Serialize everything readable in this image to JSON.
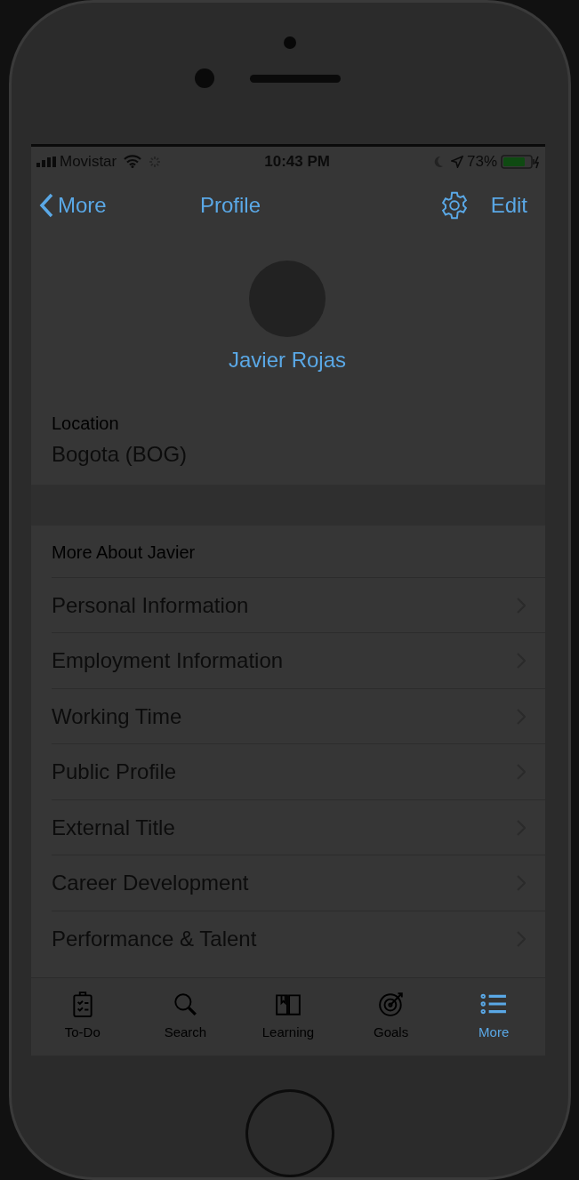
{
  "status_bar": {
    "carrier": "Movistar",
    "time": "10:43 PM",
    "battery": "73%"
  },
  "nav": {
    "back": "More",
    "title": "Profile",
    "action": "Edit"
  },
  "profile": {
    "name": "Javier Rojas",
    "fields": [
      {
        "label": "Location",
        "value": "Bogota (BOG)"
      }
    ]
  },
  "section": {
    "header": "More About Javier",
    "rows": [
      {
        "label": "Personal Information"
      },
      {
        "label": "Employment Information"
      },
      {
        "label": "Working Time"
      },
      {
        "label": "Public Profile"
      },
      {
        "label": "External Title"
      },
      {
        "label": "Career Development"
      },
      {
        "label": "Performance & Talent"
      }
    ]
  },
  "tab_bar": [
    {
      "label": "To-Do",
      "selected": false
    },
    {
      "label": "Search",
      "selected": false
    },
    {
      "label": "Learning",
      "selected": false
    },
    {
      "label": "Goals",
      "selected": false
    },
    {
      "label": "More",
      "selected": true
    }
  ]
}
